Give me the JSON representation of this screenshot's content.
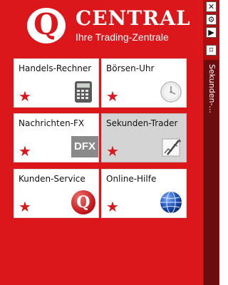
{
  "header": {
    "logo_letter": "Q",
    "brand": "CENTRAL",
    "tagline": "Ihre Trading-Zentrale"
  },
  "tiles": [
    {
      "label": "Handels-Rechner",
      "icon": "calculator-icon"
    },
    {
      "label": "Börsen-Uhr",
      "icon": "clock-icon"
    },
    {
      "label": "Nachrichten-FX",
      "icon": "dfx-icon",
      "icon_text": "DFX"
    },
    {
      "label": "Sekunden-Trader",
      "icon": "pen-chart-icon",
      "active": true
    },
    {
      "label": "Kunden-Service",
      "icon": "q-logo-icon",
      "icon_text": "Q"
    },
    {
      "label": "Online-Hilfe",
      "icon": "globe-icon"
    }
  ],
  "star": "★",
  "side": {
    "close": "✕",
    "settings": "⚙",
    "arrow": "▶",
    "pin": "⌑",
    "tab_label": "Sekunden-..."
  },
  "colors": {
    "brand_red": "#dc171b",
    "side_red": "#b20e10",
    "tab_dark": "#6a0d0e"
  }
}
